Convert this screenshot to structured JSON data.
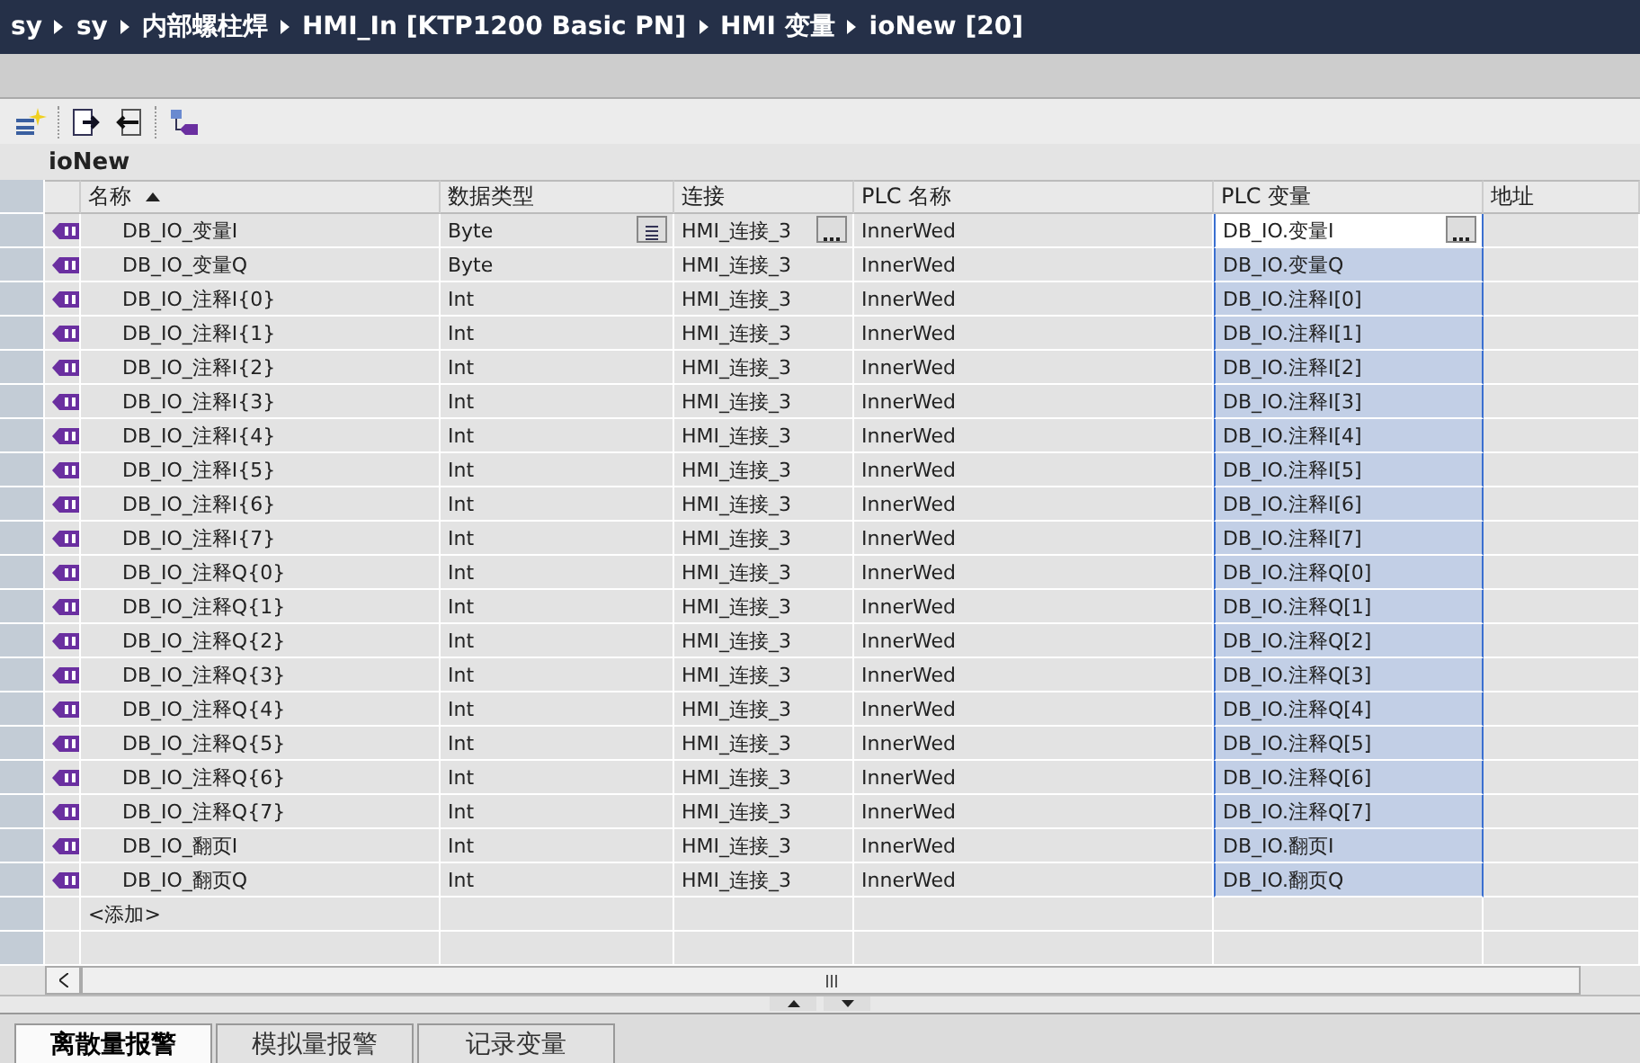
{
  "breadcrumb": [
    "sy",
    "sy",
    "内部螺柱焊",
    "HMI_In [KTP1200 Basic PN]",
    "HMI 变量",
    "ioNew [20]"
  ],
  "table_title": "ioNew",
  "columns": [
    {
      "label": "名称",
      "sorted": true
    },
    {
      "label": "数据类型",
      "sorted": false
    },
    {
      "label": "连接",
      "sorted": false
    },
    {
      "label": "PLC 名称",
      "sorted": false
    },
    {
      "label": "PLC 变量",
      "sorted": false
    },
    {
      "label": "地址",
      "sorted": false
    }
  ],
  "rows": [
    {
      "name": "DB_IO_变量I",
      "type": "Byte",
      "connection": "HMI_连接_3",
      "plc_name": "InnerWed",
      "plc_variable": "DB_IO.变量I",
      "selected": true,
      "editing": true
    },
    {
      "name": "DB_IO_变量Q",
      "type": "Byte",
      "connection": "HMI_连接_3",
      "plc_name": "InnerWed",
      "plc_variable": "DB_IO.变量Q",
      "selected": true,
      "editing": false
    },
    {
      "name": "DB_IO_注释I{0}",
      "type": "Int",
      "connection": "HMI_连接_3",
      "plc_name": "InnerWed",
      "plc_variable": "DB_IO.注释I[0]",
      "selected": true,
      "editing": false
    },
    {
      "name": "DB_IO_注释I{1}",
      "type": "Int",
      "connection": "HMI_连接_3",
      "plc_name": "InnerWed",
      "plc_variable": "DB_IO.注释I[1]",
      "selected": true,
      "editing": false
    },
    {
      "name": "DB_IO_注释I{2}",
      "type": "Int",
      "connection": "HMI_连接_3",
      "plc_name": "InnerWed",
      "plc_variable": "DB_IO.注释I[2]",
      "selected": true,
      "editing": false
    },
    {
      "name": "DB_IO_注释I{3}",
      "type": "Int",
      "connection": "HMI_连接_3",
      "plc_name": "InnerWed",
      "plc_variable": "DB_IO.注释I[3]",
      "selected": true,
      "editing": false
    },
    {
      "name": "DB_IO_注释I{4}",
      "type": "Int",
      "connection": "HMI_连接_3",
      "plc_name": "InnerWed",
      "plc_variable": "DB_IO.注释I[4]",
      "selected": true,
      "editing": false
    },
    {
      "name": "DB_IO_注释I{5}",
      "type": "Int",
      "connection": "HMI_连接_3",
      "plc_name": "InnerWed",
      "plc_variable": "DB_IO.注释I[5]",
      "selected": true,
      "editing": false
    },
    {
      "name": "DB_IO_注释I{6}",
      "type": "Int",
      "connection": "HMI_连接_3",
      "plc_name": "InnerWed",
      "plc_variable": "DB_IO.注释I[6]",
      "selected": true,
      "editing": false
    },
    {
      "name": "DB_IO_注释I{7}",
      "type": "Int",
      "connection": "HMI_连接_3",
      "plc_name": "InnerWed",
      "plc_variable": "DB_IO.注释I[7]",
      "selected": true,
      "editing": false
    },
    {
      "name": "DB_IO_注释Q{0}",
      "type": "Int",
      "connection": "HMI_连接_3",
      "plc_name": "InnerWed",
      "plc_variable": "DB_IO.注释Q[0]",
      "selected": true,
      "editing": false
    },
    {
      "name": "DB_IO_注释Q{1}",
      "type": "Int",
      "connection": "HMI_连接_3",
      "plc_name": "InnerWed",
      "plc_variable": "DB_IO.注释Q[1]",
      "selected": true,
      "editing": false
    },
    {
      "name": "DB_IO_注释Q{2}",
      "type": "Int",
      "connection": "HMI_连接_3",
      "plc_name": "InnerWed",
      "plc_variable": "DB_IO.注释Q[2]",
      "selected": true,
      "editing": false
    },
    {
      "name": "DB_IO_注释Q{3}",
      "type": "Int",
      "connection": "HMI_连接_3",
      "plc_name": "InnerWed",
      "plc_variable": "DB_IO.注释Q[3]",
      "selected": true,
      "editing": false
    },
    {
      "name": "DB_IO_注释Q{4}",
      "type": "Int",
      "connection": "HMI_连接_3",
      "plc_name": "InnerWed",
      "plc_variable": "DB_IO.注释Q[4]",
      "selected": true,
      "editing": false
    },
    {
      "name": "DB_IO_注释Q{5}",
      "type": "Int",
      "connection": "HMI_连接_3",
      "plc_name": "InnerWed",
      "plc_variable": "DB_IO.注释Q[5]",
      "selected": true,
      "editing": false
    },
    {
      "name": "DB_IO_注释Q{6}",
      "type": "Int",
      "connection": "HMI_连接_3",
      "plc_name": "InnerWed",
      "plc_variable": "DB_IO.注释Q[6]",
      "selected": true,
      "editing": false
    },
    {
      "name": "DB_IO_注释Q{7}",
      "type": "Int",
      "connection": "HMI_连接_3",
      "plc_name": "InnerWed",
      "plc_variable": "DB_IO.注释Q[7]",
      "selected": true,
      "editing": false
    },
    {
      "name": "DB_IO_翻页I",
      "type": "Int",
      "connection": "HMI_连接_3",
      "plc_name": "InnerWed",
      "plc_variable": "DB_IO.翻页I",
      "selected": true,
      "editing": false
    },
    {
      "name": "DB_IO_翻页Q",
      "type": "Int",
      "connection": "HMI_连接_3",
      "plc_name": "InnerWed",
      "plc_variable": "DB_IO.翻页Q",
      "selected": true,
      "editing": false
    }
  ],
  "add_row": "<添加>",
  "tabs": [
    {
      "label": "离散量报警",
      "selected": true
    },
    {
      "label": "模拟量报警",
      "selected": false
    },
    {
      "label": "记录变量",
      "selected": false
    }
  ]
}
